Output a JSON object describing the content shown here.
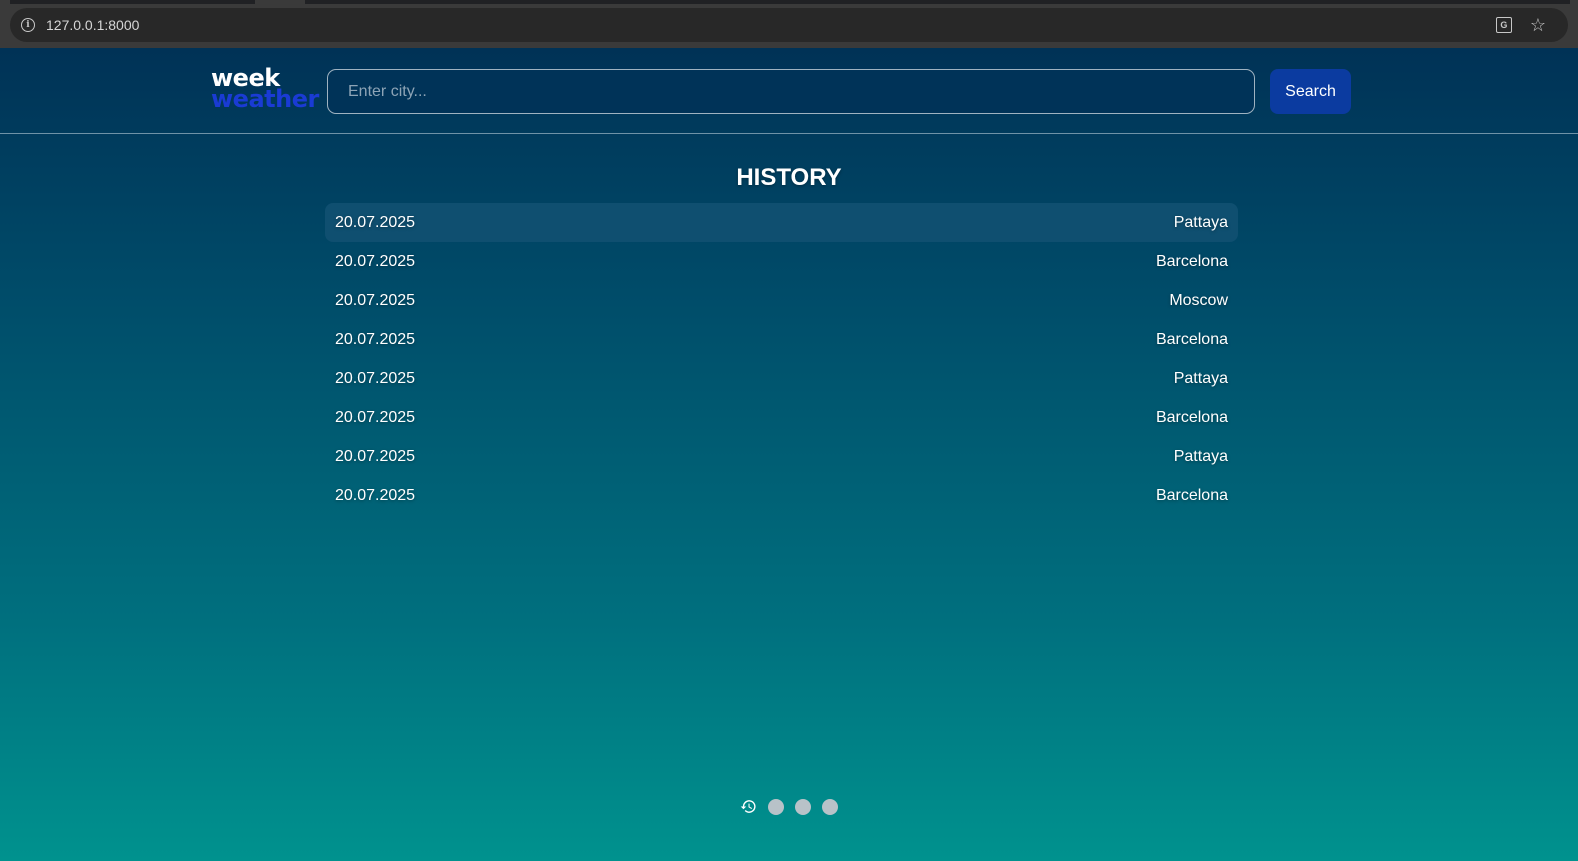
{
  "browser": {
    "url": "127.0.0.1:8000"
  },
  "header": {
    "logo_top": "week",
    "logo_bottom": "weather",
    "search_placeholder": "Enter city...",
    "search_label": "Search"
  },
  "history": {
    "title": "HISTORY",
    "items": [
      {
        "date": "20.07.2025",
        "city": "Pattaya"
      },
      {
        "date": "20.07.2025",
        "city": "Barcelona"
      },
      {
        "date": "20.07.2025",
        "city": "Moscow"
      },
      {
        "date": "20.07.2025",
        "city": "Barcelona"
      },
      {
        "date": "20.07.2025",
        "city": "Pattaya"
      },
      {
        "date": "20.07.2025",
        "city": "Barcelona"
      },
      {
        "date": "20.07.2025",
        "city": "Pattaya"
      },
      {
        "date": "20.07.2025",
        "city": "Barcelona"
      }
    ]
  },
  "pager": {
    "icon": "history-icon",
    "dot_count": 3
  },
  "colors": {
    "accent": "#0b3ba0",
    "logo_accent": "#1a3bd4",
    "gradient_top": "#003256",
    "gradient_bottom": "#00928e"
  }
}
